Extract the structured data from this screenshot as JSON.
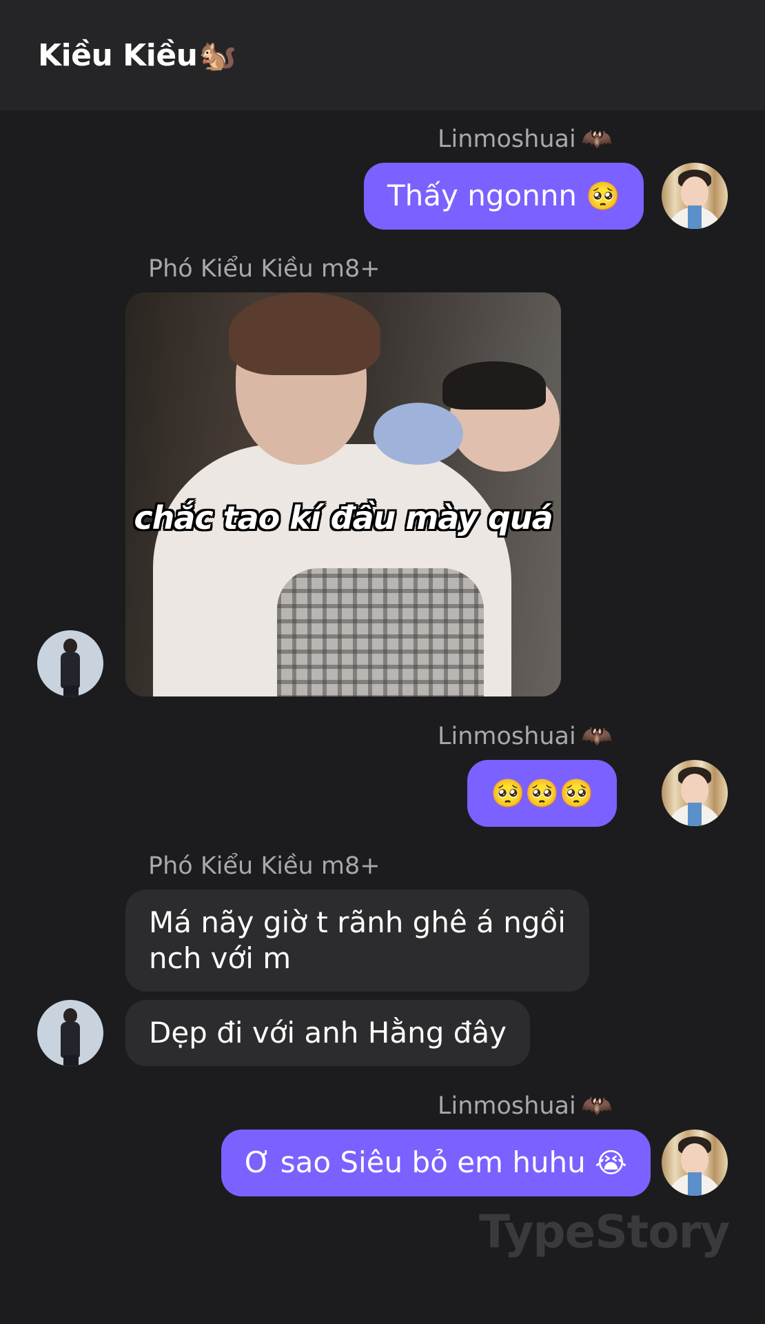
{
  "header": {
    "title": "Kiều Kiều",
    "title_emoji": "🐿️"
  },
  "messages": [
    {
      "sender": "Linmoshuai",
      "sender_emoji": "🦇",
      "text": "Thấy ngonnn",
      "emoji": "🥺"
    },
    {
      "sender": "Phó Kiểu Kiều m8+",
      "image_caption": "chắc tao kí đầu mày quá"
    },
    {
      "sender": "Linmoshuai",
      "sender_emoji": "🦇",
      "text": "🥺🥺🥺"
    },
    {
      "sender": "Phó Kiểu Kiều m8+",
      "text_line1": "Má nãy giờ t rãnh ghê á ngồi",
      "text_line2": "nch với m",
      "text2": "Dẹp đi với anh Hằng đây"
    },
    {
      "sender": "Linmoshuai",
      "sender_emoji": "🦇",
      "text": "Ơ sao Siêu bỏ em huhu",
      "emoji": "😭"
    }
  ],
  "watermark": "TypeStory"
}
